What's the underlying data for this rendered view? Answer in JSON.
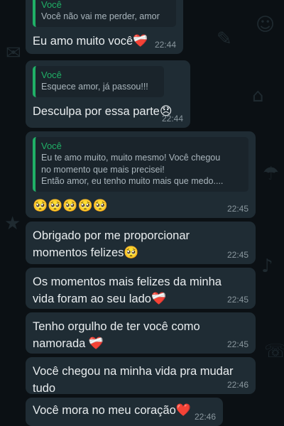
{
  "messages": [
    {
      "quote_sender": "Você",
      "quote_text": "Você não vai me perder, amor",
      "text": "Eu amo muito você",
      "emoji": "❤️‍🩹",
      "time": "22:44"
    },
    {
      "quote_sender": "Você",
      "quote_text": "Esquece amor, já passou!!!",
      "text": "Desculpa por essa parte",
      "emoji": "😞",
      "time": "22:44"
    },
    {
      "quote_sender": "Você",
      "quote_lines": [
        "Eu te amo muito, muito mesmo! Você chegou",
        "no momento que mais precisei!",
        "Então amor,  eu tenho muito mais que medo...."
      ],
      "text": "",
      "emoji": "🥺🥺🥺🥺🥺",
      "time": "22:45"
    },
    {
      "text": "Obrigado por me proporcionar momentos felizes",
      "emoji": "🥺",
      "time": "22:45"
    },
    {
      "text": "Os momentos mais felizes da minha vida foram ao seu lado",
      "emoji": "❤️‍🩹",
      "time": "22:45"
    },
    {
      "text": "Tenho orgulho de ter você como namorada",
      "emoji": "❤️‍🩹",
      "time": "22:45"
    },
    {
      "text": "Você chegou na minha vida pra mudar tudo",
      "emoji": "",
      "time": "22:46"
    },
    {
      "text": "Você mora no meu coração",
      "emoji": "❤️",
      "time": "22:46"
    }
  ]
}
